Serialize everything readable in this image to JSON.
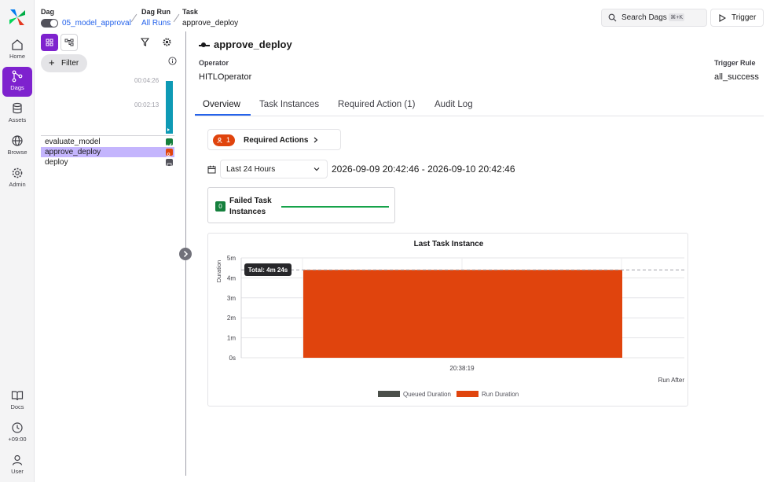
{
  "nav": {
    "items": [
      {
        "label": "Home",
        "icon": "home-icon"
      },
      {
        "label": "Dags",
        "icon": "dags-icon"
      },
      {
        "label": "Assets",
        "icon": "database-icon"
      },
      {
        "label": "Browse",
        "icon": "globe-icon"
      },
      {
        "label": "Admin",
        "icon": "gear-icon"
      }
    ],
    "bottom": [
      {
        "label": "Docs",
        "icon": "book-icon"
      },
      {
        "label": "+09:00",
        "icon": "clock-icon"
      },
      {
        "label": "User",
        "icon": "user-icon"
      }
    ]
  },
  "breadcrumb": {
    "dag_label": "Dag",
    "dag_value": "05_model_approval",
    "run_label": "Dag Run",
    "run_value": "All Runs",
    "task_label": "Task",
    "task_value": "approve_deploy"
  },
  "header": {
    "search_label": "Search Dags",
    "search_shortcut": "⌘+K",
    "trigger_label": "Trigger"
  },
  "panel": {
    "filter_label": "Filter",
    "duration_top": "00:04:26",
    "duration_mid": "00:02:13",
    "tasks": [
      {
        "name": "evaluate_model",
        "status_color": "#15803d"
      },
      {
        "name": "approve_deploy",
        "status_color": "#e0440d"
      },
      {
        "name": "deploy",
        "status_color": "#52525b"
      }
    ]
  },
  "task": {
    "title": "approve_deploy",
    "operator_label": "Operator",
    "operator_value": "HITLOperator",
    "trigger_rule_label": "Trigger Rule",
    "trigger_rule_value": "all_success"
  },
  "tabs": [
    "Overview",
    "Task Instances",
    "Required Action (1)",
    "Audit Log"
  ],
  "required_actions": {
    "count": "1",
    "label": "Required Actions"
  },
  "time_range": {
    "selected": "Last 24 Hours",
    "range_text": "2026-09-09 20:42:46 - 2026-09-10 20:42:46"
  },
  "failed_card": {
    "count": "0",
    "label": "Failed Task Instances"
  },
  "chart_data": {
    "type": "bar",
    "title": "Last Task Instance",
    "categories": [
      "20:38:19"
    ],
    "series": [
      {
        "name": "Queued Duration",
        "values": [
          0
        ],
        "color": "#4b4f4a"
      },
      {
        "name": "Run Duration",
        "values": [
          264
        ],
        "color": "#e0440d"
      }
    ],
    "ylabel": "Duration",
    "xlabel": "Run After",
    "yticks": [
      "0s",
      "1m",
      "2m",
      "3m",
      "4m",
      "5m"
    ],
    "ylim": [
      0,
      300
    ],
    "tooltip": "Total: 4m 24s",
    "legend": "bottom"
  },
  "colors": {
    "accent": "#7e22ce",
    "link": "#2563eb"
  }
}
